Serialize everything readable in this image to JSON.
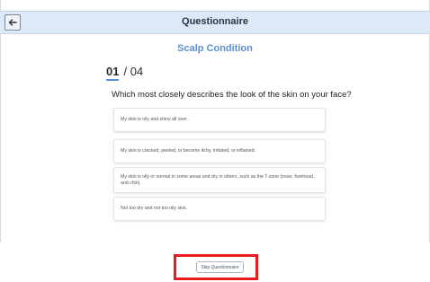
{
  "header": {
    "title": "Questionnaire",
    "back_icon": "arrow-left-icon"
  },
  "section": {
    "title": "Scalp Condition"
  },
  "progress": {
    "current": "01",
    "total": "/ 04"
  },
  "question": {
    "text": "Which most closely describes the look of the skin on your face?"
  },
  "options": [
    {
      "label": "My skin is oily and shiny all over."
    },
    {
      "label": "My skin is cracked, peeled, or become itchy, irritated, or inflamed."
    },
    {
      "label": "My skin is oily or normal in some areas and dry in others, such as the T-zone (nose, forehead, and chin)."
    },
    {
      "label": "Not too dry and not too oily skin."
    }
  ],
  "footer": {
    "skip_label": "Skip Questionnaire",
    "highlight_color": "#e81a1a"
  },
  "colors": {
    "header_bg": "#dde9f7",
    "accent": "#5b8fd6"
  }
}
